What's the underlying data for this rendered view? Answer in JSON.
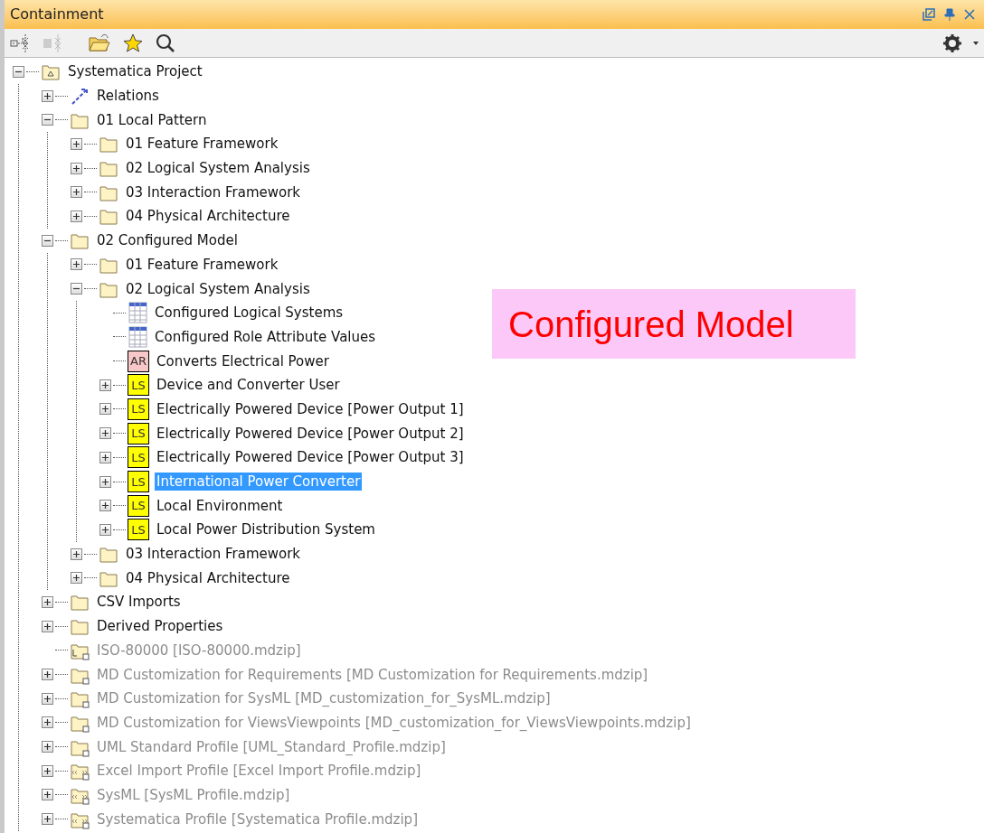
{
  "panel": {
    "title": "Containment"
  },
  "tree": [
    {
      "label": "Systematica Project",
      "kind": "project",
      "expanded": true,
      "children": [
        {
          "label": "Relations",
          "kind": "relations",
          "expanded": false
        },
        {
          "label": "01 Local Pattern",
          "kind": "folder",
          "expanded": true,
          "children": [
            {
              "label": "01 Feature Framework",
              "kind": "folder",
              "expanded": false
            },
            {
              "label": "02 Logical System Analysis",
              "kind": "folder",
              "expanded": false
            },
            {
              "label": "03 Interaction Framework",
              "kind": "folder",
              "expanded": false
            },
            {
              "label": "04 Physical Architecture",
              "kind": "folder",
              "expanded": false
            }
          ]
        },
        {
          "label": "02 Configured Model",
          "kind": "folder",
          "expanded": true,
          "children": [
            {
              "label": "01 Feature Framework",
              "kind": "folder",
              "expanded": false
            },
            {
              "label": "02 Logical System Analysis",
              "kind": "folder",
              "expanded": true,
              "children": [
                {
                  "label": "Configured Logical Systems",
                  "kind": "table"
                },
                {
                  "label": "Configured Role Attribute Values",
                  "kind": "table"
                },
                {
                  "label": "Converts Electrical Power",
                  "kind": "badge",
                  "badge": "AR",
                  "color": "#f8c8c8"
                },
                {
                  "label": "Device and Converter User",
                  "kind": "badge",
                  "badge": "LS",
                  "color": "#ffff00",
                  "expanded": false
                },
                {
                  "label": "Electrically Powered Device [Power Output 1]",
                  "kind": "badge",
                  "badge": "LS",
                  "color": "#ffff00",
                  "expanded": false
                },
                {
                  "label": "Electrically Powered Device [Power Output 2]",
                  "kind": "badge",
                  "badge": "LS",
                  "color": "#ffff00",
                  "expanded": false
                },
                {
                  "label": "Electrically Powered Device [Power Output 3]",
                  "kind": "badge",
                  "badge": "LS",
                  "color": "#ffff00",
                  "expanded": false
                },
                {
                  "label": "International Power Converter",
                  "kind": "badge",
                  "badge": "LS",
                  "color": "#ffff00",
                  "expanded": false,
                  "selected": true
                },
                {
                  "label": "Local Environment",
                  "kind": "badge",
                  "badge": "LS",
                  "color": "#ffff00",
                  "expanded": false
                },
                {
                  "label": "Local Power Distribution System",
                  "kind": "badge",
                  "badge": "LS",
                  "color": "#ffff00",
                  "expanded": false
                }
              ]
            },
            {
              "label": "03 Interaction Framework",
              "kind": "folder",
              "expanded": false
            },
            {
              "label": "04 Physical Architecture",
              "kind": "folder",
              "expanded": false
            }
          ]
        },
        {
          "label": "CSV Imports",
          "kind": "folder",
          "expanded": false
        },
        {
          "label": "Derived Properties",
          "kind": "folder",
          "expanded": false
        },
        {
          "label": "ISO-80000 [ISO-80000.mdzip]",
          "kind": "library",
          "disabled": true
        },
        {
          "label": "MD Customization for Requirements [MD Customization for Requirements.mdzip]",
          "kind": "used_project",
          "expanded": false,
          "disabled": true
        },
        {
          "label": "MD Customization for SysML [MD_customization_for_SysML.mdzip]",
          "kind": "used_project",
          "expanded": false,
          "disabled": true
        },
        {
          "label": "MD Customization for ViewsViewpoints [MD_customization_for_ViewsViewpoints.mdzip]",
          "kind": "used_project",
          "expanded": false,
          "disabled": true
        },
        {
          "label": "UML Standard Profile [UML_Standard_Profile.mdzip]",
          "kind": "used_project",
          "expanded": false,
          "disabled": true
        },
        {
          "label": "Excel Import Profile [Excel Import Profile.mdzip]",
          "kind": "used_profile",
          "expanded": false,
          "disabled": true
        },
        {
          "label": "SysML [SysML Profile.mdzip]",
          "kind": "used_profile",
          "expanded": false,
          "disabled": true
        },
        {
          "label": "Systematica Profile [Systematica Profile.mdzip]",
          "kind": "used_profile",
          "expanded": false,
          "disabled": true
        }
      ]
    }
  ],
  "callout": {
    "text": "Configured Model"
  }
}
